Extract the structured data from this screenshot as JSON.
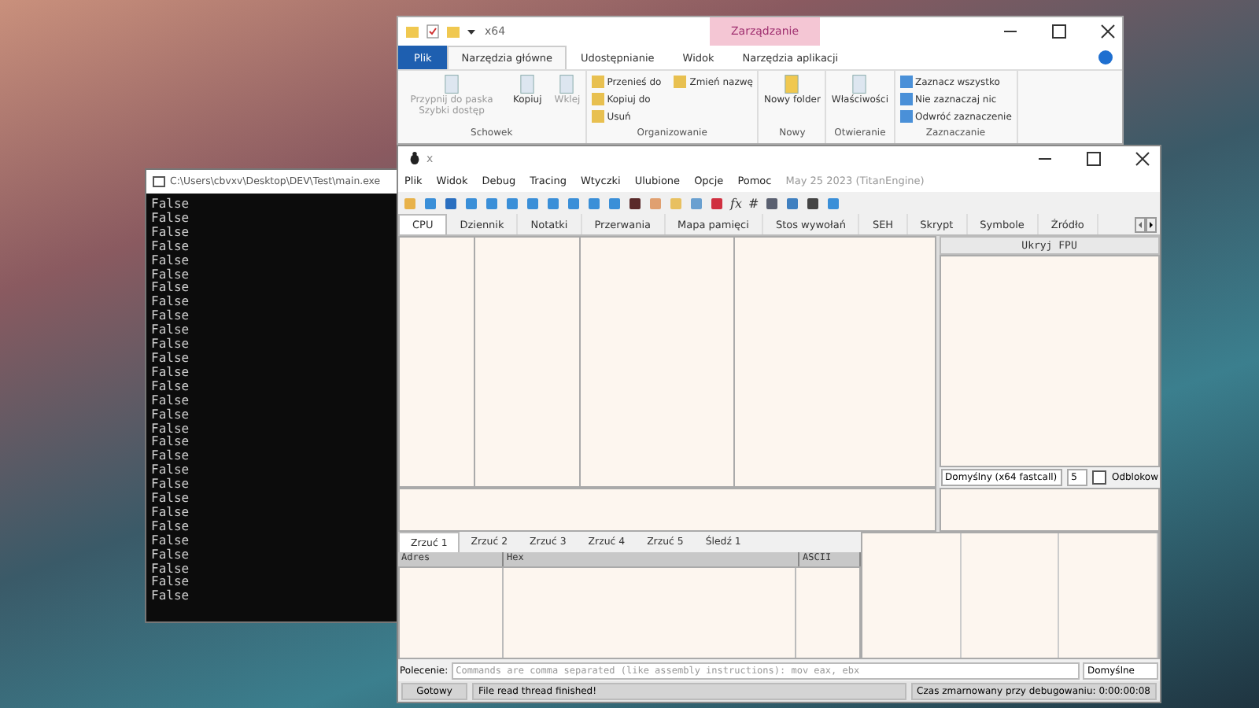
{
  "explorer": {
    "title": "x64",
    "context_label": "Zarządzanie",
    "tabs": [
      {
        "label": "Plik",
        "kind": "file",
        "selected": false
      },
      {
        "label": "Narzędzia główne",
        "kind": "tab",
        "selected": true
      },
      {
        "label": "Udostępnianie",
        "kind": "tab",
        "selected": false
      },
      {
        "label": "Widok",
        "kind": "tab",
        "selected": false
      },
      {
        "label": "Narzędzia aplikacji",
        "kind": "tab",
        "selected": false
      }
    ],
    "groups": [
      {
        "name": "Schowek",
        "items": [
          {
            "label": "Przypnij do paska Szybki dostęp",
            "kind": "large",
            "disabled": true
          },
          {
            "label": "Kopiuj",
            "kind": "large",
            "disabled": false
          },
          {
            "label": "Wklej",
            "kind": "large",
            "disabled": true
          }
        ]
      },
      {
        "name": "Organizowanie",
        "items": [
          {
            "label": "Przenieś do",
            "kind": "small",
            "disabled": false
          },
          {
            "label": "Kopiuj do",
            "kind": "small",
            "disabled": false
          },
          {
            "label": "Usuń",
            "kind": "small",
            "disabled": false
          },
          {
            "label": "Zmień nazwę",
            "kind": "small",
            "disabled": false
          }
        ]
      },
      {
        "name": "Nowy",
        "items": [
          {
            "label": "Nowy folder",
            "kind": "large",
            "disabled": false
          }
        ]
      },
      {
        "name": "Otwieranie",
        "items": [
          {
            "label": "Właściwości",
            "kind": "large",
            "disabled": false
          }
        ]
      },
      {
        "name": "Zaznaczanie",
        "items": [
          {
            "label": "Zaznacz wszystko",
            "kind": "small",
            "disabled": false
          },
          {
            "label": "Nie zaznaczaj nic",
            "kind": "small",
            "disabled": false
          },
          {
            "label": "Odwróć zaznaczenie",
            "kind": "small",
            "disabled": false
          }
        ]
      }
    ]
  },
  "console": {
    "title": "C:\\Users\\cbvxv\\Desktop\\DEV\\Test\\main.exe",
    "lines": [
      "False",
      "False",
      "False",
      "False",
      "False",
      "False",
      "False",
      "False",
      "False",
      "False",
      "False",
      "False",
      "False",
      "False",
      "False",
      "False",
      "False",
      "False",
      "False",
      "False",
      "False",
      "False",
      "False",
      "False",
      "False",
      "False",
      "False",
      "False",
      "False"
    ]
  },
  "debugger": {
    "title": "x",
    "menu": [
      "Plik",
      "Widok",
      "Debug",
      "Tracing",
      "Wtyczki",
      "Ulubione",
      "Opcje",
      "Pomoc"
    ],
    "version": "May 25 2023 (TitanEngine)",
    "toolbar_text": [
      "fx",
      "#"
    ],
    "tabs": [
      {
        "label": "CPU",
        "selected": true
      },
      {
        "label": "Dziennik",
        "selected": false
      },
      {
        "label": "Notatki",
        "selected": false
      },
      {
        "label": "Przerwania",
        "selected": false
      },
      {
        "label": "Mapa pamięci",
        "selected": false
      },
      {
        "label": "Stos wywołań",
        "selected": false
      },
      {
        "label": "SEH",
        "selected": false
      },
      {
        "label": "Skrypt",
        "selected": false
      },
      {
        "label": "Symbole",
        "selected": false
      },
      {
        "label": "Źródło",
        "selected": false
      }
    ],
    "fpu_button": "Ukryj FPU",
    "calling_convention": "Domyślny (x64 fastcall)",
    "arg_count": "5",
    "unlock": {
      "label": "Odblokow",
      "checked": false
    },
    "dump_tabs": [
      {
        "label": "Zrzuć 1",
        "selected": true
      },
      {
        "label": "Zrzuć 2",
        "selected": false
      },
      {
        "label": "Zrzuć 3",
        "selected": false
      },
      {
        "label": "Zrzuć 4",
        "selected": false
      },
      {
        "label": "Zrzuć 5",
        "selected": false
      },
      {
        "label": "Śledź 1",
        "selected": false
      }
    ],
    "dump_columns": [
      "Adres",
      "Hex",
      "ASCII"
    ],
    "command": {
      "label": "Polecenie:",
      "placeholder": "Commands are comma separated (like assembly instructions): mov eax, ebx",
      "mode": "Domyślne"
    },
    "status_bar": {
      "state": "Gotowy",
      "message": "File read thread finished!",
      "time": "Czas zmarnowany przy debugowaniu: 0:00:00:08"
    }
  }
}
